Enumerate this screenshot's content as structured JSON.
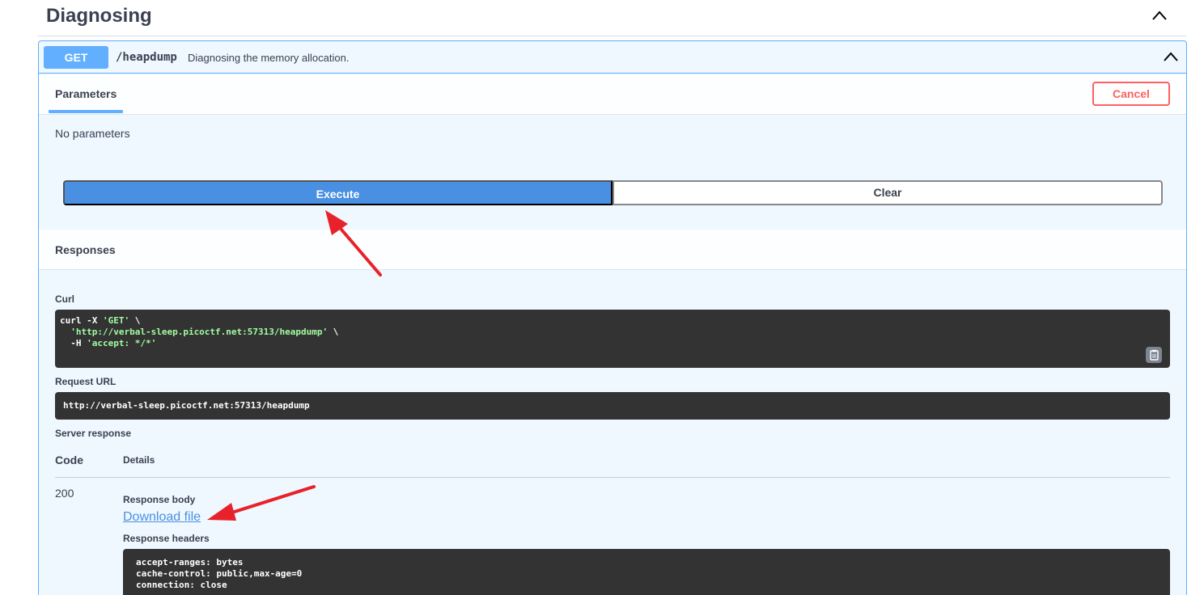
{
  "section": {
    "title": "Diagnosing"
  },
  "operation": {
    "method": "GET",
    "path": "/heapdump",
    "description": "Diagnosing the memory allocation."
  },
  "tabs": {
    "parameters": "Parameters",
    "cancel_label": "Cancel"
  },
  "parameters": {
    "empty_text": "No parameters"
  },
  "actions": {
    "execute_label": "Execute",
    "clear_label": "Clear"
  },
  "responses": {
    "title": "Responses",
    "curl_label": "Curl",
    "curl": {
      "line1_cmd": "curl -X ",
      "line1_str": "'GET'",
      "line1_tail": " \\",
      "line2_str": "  'http://verbal-sleep.picoctf.net:57313/heapdump'",
      "line2_tail": " \\",
      "line3_cmd": "  -H ",
      "line3_str": "'accept: */*'"
    },
    "request_url_label": "Request URL",
    "request_url": "http://verbal-sleep.picoctf.net:57313/heapdump",
    "server_response_label": "Server response",
    "col_code": "Code",
    "col_details": "Details",
    "code": "200",
    "response_body_label": "Response body",
    "download_label": "Download file",
    "response_headers_label": "Response headers",
    "headers": [
      "accept-ranges: bytes",
      "cache-control: public,max-age=0",
      "connection: close"
    ]
  },
  "icons": {
    "section_toggle": "chevron-up-icon",
    "op_toggle": "chevron-up-icon",
    "copy": "clipboard-icon",
    "annotation": "red-arrow-icon"
  },
  "colors": {
    "get_method": "#61affe",
    "execute": "#4990e2",
    "cancel": "#ff6060",
    "code_bg": "#333333",
    "annotation_arrow": "#e8222a"
  }
}
